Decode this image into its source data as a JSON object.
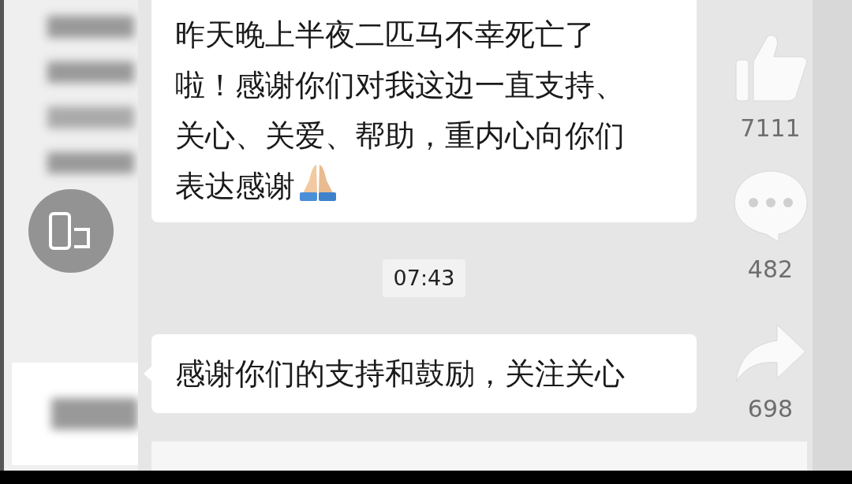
{
  "chat": [
    {
      "kind": "message",
      "lines": [
        "昨天晚上半夜二匹马不幸死亡了",
        "啦！感谢你们对我这边一直支持、",
        "关心、关爱、帮助，重内心向你们",
        "表达感谢"
      ],
      "praying_hands_emoji": true,
      "tail": false
    },
    {
      "kind": "time",
      "text": "07:43"
    },
    {
      "kind": "message",
      "lines": [
        "感谢你们的支持和鼓励，关注关心"
      ],
      "tail": true
    }
  ],
  "actions": [
    {
      "kind": "like",
      "count": "7111"
    },
    {
      "kind": "comment",
      "count": "482"
    },
    {
      "kind": "share",
      "count": "698"
    }
  ]
}
